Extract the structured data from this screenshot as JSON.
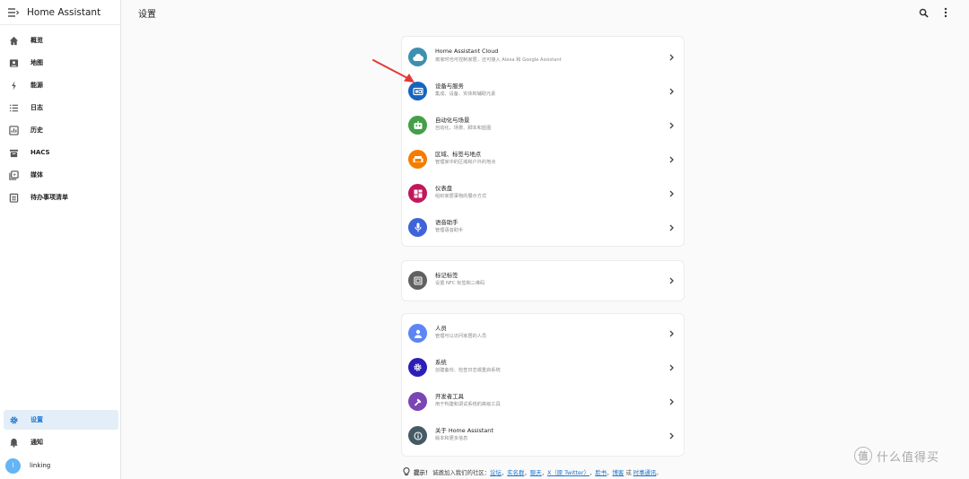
{
  "app": {
    "title": "Home Assistant"
  },
  "page": {
    "title": "设置"
  },
  "sidebar": {
    "items": [
      {
        "label": "概览",
        "icon": "home-icon"
      },
      {
        "label": "地图",
        "icon": "map-icon"
      },
      {
        "label": "能源",
        "icon": "lightning-icon"
      },
      {
        "label": "日志",
        "icon": "list-icon"
      },
      {
        "label": "历史",
        "icon": "chart-box-icon"
      },
      {
        "label": "HACS",
        "icon": "hacs-icon"
      },
      {
        "label": "媒体",
        "icon": "media-icon"
      },
      {
        "label": "待办事项清单",
        "icon": "clipboard-list-icon"
      }
    ],
    "settings": {
      "label": "设置",
      "icon": "gear-icon"
    },
    "notifications": {
      "label": "通知",
      "icon": "bell-icon"
    },
    "user": {
      "initial": "l",
      "label": "linking"
    }
  },
  "groups": [
    [
      {
        "title": "Home Assistant Cloud",
        "subtitle": "离家时也可控制家居，还可接入 Alexa 和 Google Assistant",
        "color": "#3e8fb0",
        "icon": "cloud-icon"
      },
      {
        "title": "设备与服务",
        "subtitle": "集成、设备、实体和辅助元素",
        "color": "#1565c0",
        "icon": "devices-icon"
      },
      {
        "title": "自动化与场景",
        "subtitle": "自动化、场景、脚本和蓝图",
        "color": "#43a047",
        "icon": "robot-icon"
      },
      {
        "title": "区域、标签与地点",
        "subtitle": "管理家中的区域和户外的地点",
        "color": "#f57c00",
        "icon": "sofa-icon"
      },
      {
        "title": "仪表盘",
        "subtitle": "组织家居事物的展示方式",
        "color": "#c2185b",
        "icon": "dashboard-icon"
      },
      {
        "title": "语音助手",
        "subtitle": "管理语音助手",
        "color": "#3f63d8",
        "icon": "microphone-icon"
      }
    ],
    [
      {
        "title": "标记标签",
        "subtitle": "设置 NFC 标签和二维码",
        "color": "#616161",
        "icon": "nfc-icon"
      }
    ],
    [
      {
        "title": "人员",
        "subtitle": "管理可以访问家居的人员",
        "color": "#5c85f5",
        "icon": "person-icon"
      },
      {
        "title": "系统",
        "subtitle": "创建备份、检查日志或重启系统",
        "color": "#2c1fb8",
        "icon": "cog-icon"
      },
      {
        "title": "开发者工具",
        "subtitle": "用于构建和调试系统的高级工具",
        "color": "#7b45b5",
        "icon": "hammer-icon"
      },
      {
        "title": "关于 Home Assistant",
        "subtitle": "版本和更多信息",
        "color": "#455a64",
        "icon": "info-icon"
      }
    ]
  ],
  "tip": {
    "label": "提示！",
    "text": "诚邀加入我们的社区：",
    "links": [
      "论坛",
      "实名群",
      "聊天",
      "X（原 Twitter）",
      "脸书",
      "博客",
      "时事通讯"
    ],
    "seps": [
      "，",
      "，",
      "，",
      "，",
      "，",
      "或"
    ],
    "end": "。"
  },
  "watermark": {
    "badge": "值",
    "text": "什么值得买"
  },
  "colors": {
    "accent": "#1976d2",
    "arrow": "#e53935"
  }
}
